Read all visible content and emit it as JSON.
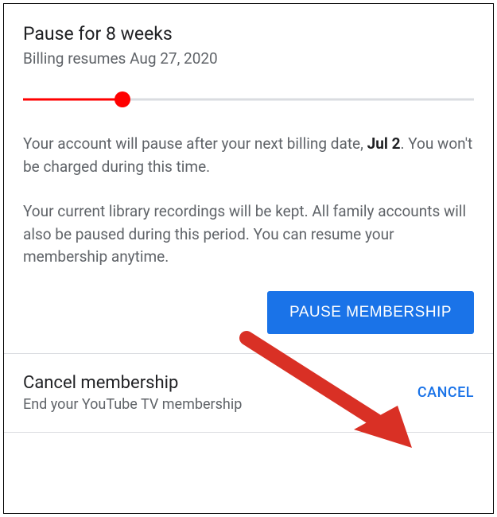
{
  "pause": {
    "title": "Pause for 8 weeks",
    "subtitle": "Billing resumes Aug 27, 2020",
    "body1_pre": "Your account will pause after your next billing date, ",
    "body1_date": "Jul 2",
    "body1_post": ". You won't be charged during this time.",
    "body2": "Your current library recordings will be kept. All family accounts will also be paused during this period. You can resume your membership anytime.",
    "button_label": "PAUSE MEMBERSHIP"
  },
  "cancel": {
    "title": "Cancel membership",
    "subtitle": "End your YouTube TV membership",
    "link_label": "CANCEL"
  }
}
